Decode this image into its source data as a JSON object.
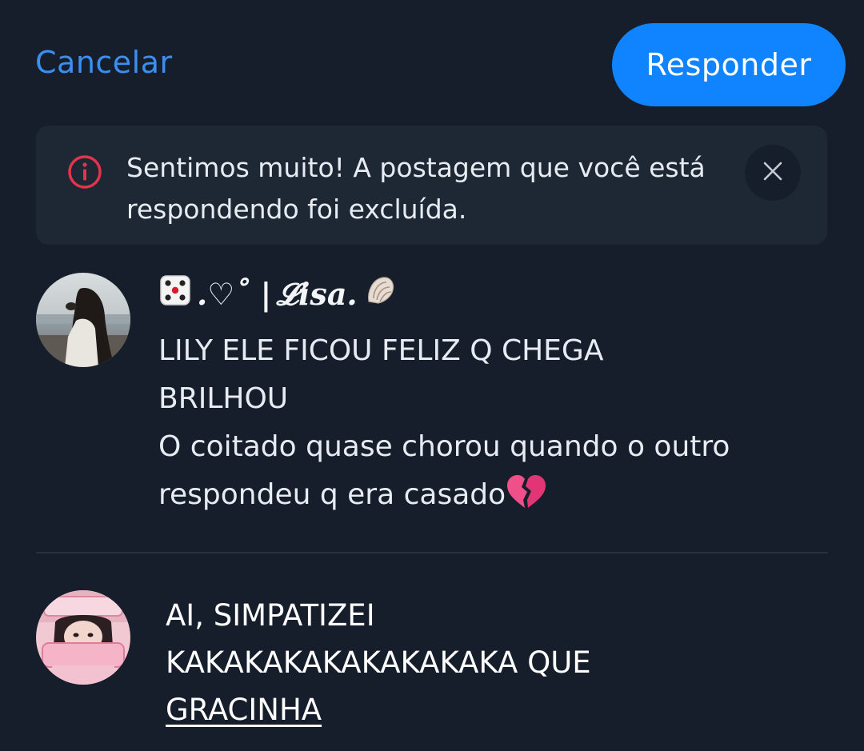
{
  "header": {
    "cancel_label": "Cancelar",
    "reply_label": "Responder"
  },
  "notice": {
    "message": "Sentimos muito! A postagem que você está respondendo foi excluída.",
    "icon": "info-icon",
    "dismiss_icon": "close-icon"
  },
  "original_post": {
    "author_prefix": ".♡˚ | ",
    "author_name": "𝓛isa.",
    "author_prefix_emoji": "die-icon",
    "author_suffix_emoji": "shell-icon",
    "text": "LILY ELE FICOU FELIZ Q CHEGA\nBRILHOU\nO coitado quase chorou quando o outro\nrespondeu q era casado",
    "trailing_emoji": "broken-heart-icon"
  },
  "reply_draft": {
    "text_main": "AI, SIMPATIZEI\nKAKAKAKAKAKAKAKAKA QUE\n",
    "text_underlined": "GRACINHA"
  },
  "colors": {
    "background": "#161e2b",
    "accent": "#1083fe",
    "link": "#3b8ff0",
    "banner": "#1e2835",
    "error": "#e2344a"
  }
}
